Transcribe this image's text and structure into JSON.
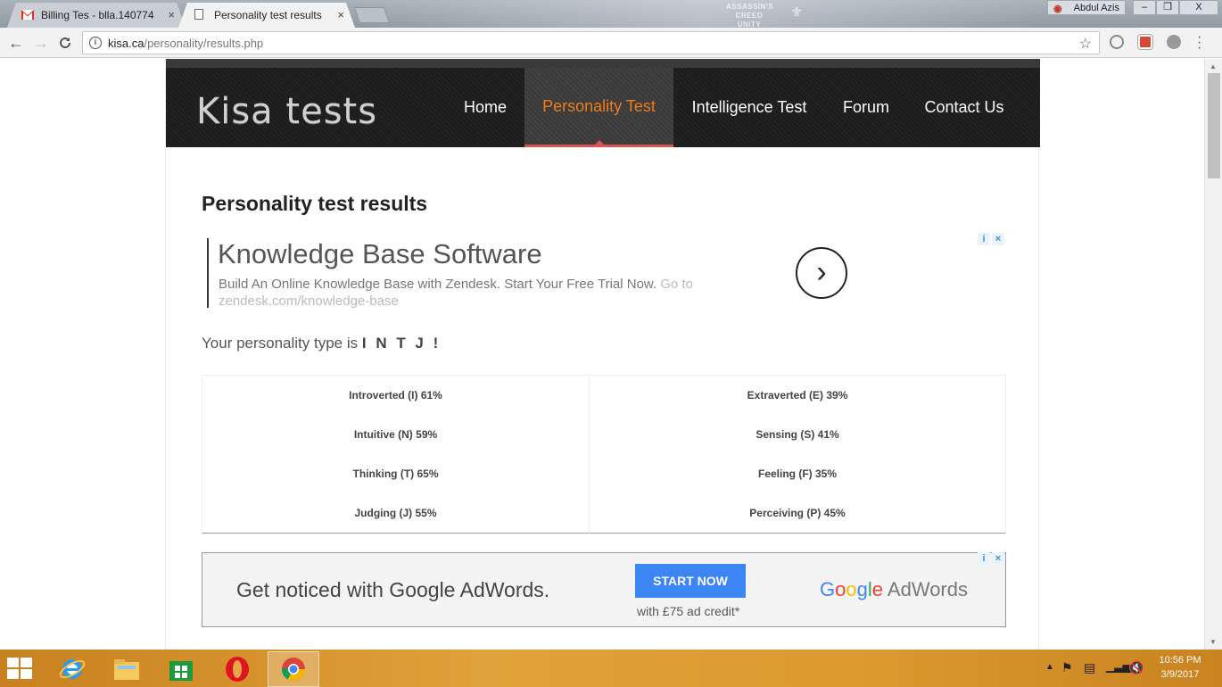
{
  "browser": {
    "tabs": [
      {
        "title": "Billing Tes - blla.140774",
        "active": false
      },
      {
        "title": "Personality test results",
        "active": true
      }
    ],
    "tab_close": "×",
    "user_name": "Abdul Azis",
    "window_min": "–",
    "window_max": "❐",
    "window_close": "X",
    "game_logo_text": "ASSASSIN'S CREED UNITY",
    "url_domain": "kisa.ca",
    "url_path": "/personality/results.php",
    "info_icon": "i",
    "back_icon": "←",
    "forward_icon": "→",
    "reload_icon": "C",
    "star_icon": "☆",
    "menu_icon": "⋮"
  },
  "site": {
    "logo": "Kisa tests",
    "nav": [
      {
        "label": "Home",
        "active": false
      },
      {
        "label": "Personality Test",
        "active": true
      },
      {
        "label": "Intelligence Test",
        "active": false
      },
      {
        "label": "Forum",
        "active": false
      },
      {
        "label": "Contact Us",
        "active": false
      }
    ],
    "active_color": "#f07c1b"
  },
  "page": {
    "heading": "Personality test results",
    "ad1": {
      "title": "Knowledge Base Software",
      "description": "Build An Online Knowledge Base with Zendesk. Start Your Free Trial Now.",
      "link": "Go to zendesk.com/knowledge-base",
      "arrow": "›"
    },
    "adchoices_info": "i",
    "adchoices_close": "×",
    "result_prefix": "Your personality type is",
    "result_type": "I N T J !",
    "results": [
      {
        "left": "Introverted (I) 61%",
        "right": "Extraverted (E) 39%"
      },
      {
        "left": "Intuitive (N) 59%",
        "right": "Sensing (S) 41%"
      },
      {
        "left": "Thinking (T) 65%",
        "right": "Feeling (F) 35%"
      },
      {
        "left": "Judging (J) 55%",
        "right": "Perceiving (P) 45%"
      }
    ],
    "ad2": {
      "text": "Get noticed with Google AdWords.",
      "button": "START NOW",
      "credit": "with £75 ad credit*",
      "brand_google": [
        "G",
        "o",
        "o",
        "g",
        "l",
        "e"
      ],
      "brand_suffix": " AdWords"
    }
  },
  "taskbar": {
    "time": "10:56 PM",
    "date": "3/9/2017",
    "apps": [
      "internet-explorer",
      "file-explorer",
      "store",
      "opera",
      "chrome"
    ]
  }
}
